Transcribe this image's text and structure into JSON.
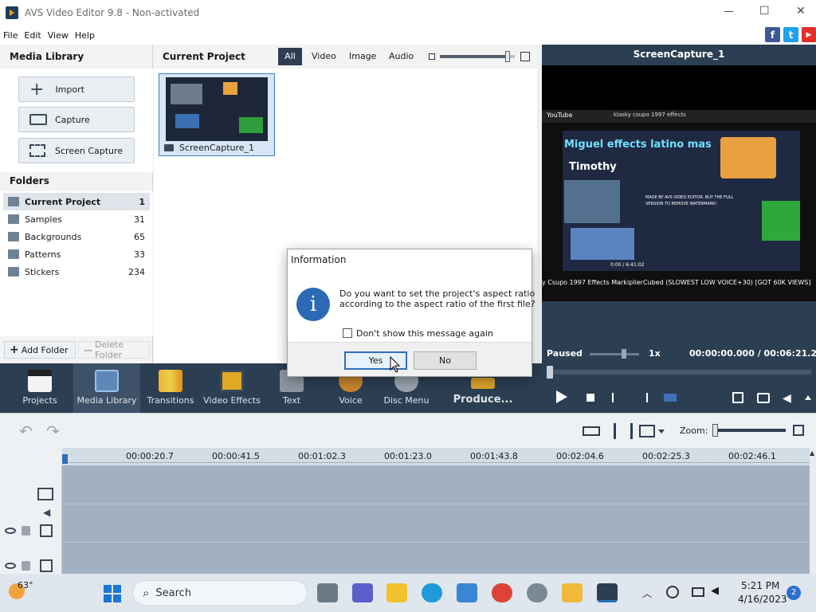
{
  "window": {
    "title": "AVS Video Editor 9.8 - Non-activated",
    "minimize": "—",
    "maximize": "☐",
    "close": "✕"
  },
  "menu": [
    "File",
    "Edit",
    "View",
    "Help"
  ],
  "social": {
    "facebook": "f",
    "twitter": "t",
    "youtube": "▶"
  },
  "media_library": {
    "title": "Media Library",
    "buttons": {
      "import": "Import",
      "capture": "Capture",
      "screen_capture": "Screen Capture"
    },
    "folders_title": "Folders",
    "folders": [
      {
        "name": "Current Project",
        "count": "1"
      },
      {
        "name": "Samples",
        "count": "31"
      },
      {
        "name": "Backgrounds",
        "count": "65"
      },
      {
        "name": "Patterns",
        "count": "33"
      },
      {
        "name": "Stickers",
        "count": "234"
      }
    ],
    "add_folder": "Add Folder",
    "delete_folder": "Delete Folder"
  },
  "project": {
    "title": "Current Project",
    "filters": [
      "All",
      "Video",
      "Image",
      "Audio"
    ],
    "zoom_level": 0.9,
    "clip_name": "ScreenCapture_1"
  },
  "preview": {
    "title": "ScreenCapture_1",
    "video_caption": "Miguel effects latino mas",
    "video_subtitle": "Timothy",
    "video_search": "klasky csupo 1997 effects",
    "video_title_text": "y Csupo 1997 Effects MarkiplierCubed (SLOWEST LOW VOICE+30) [GOT 60K VIEWS]",
    "watermark": "MADE BY AVS VIDEO EDITOR. BUY THE FULL VERSION TO REMOVE WATERMARK!",
    "youtube_label": "YouTube",
    "video_time": "0:00 / 6:41:02",
    "status": "Paused",
    "speed": "1x",
    "time": "00:00:00.000 / 00:06:21.200",
    "progress": 0.0
  },
  "toolbar": [
    {
      "label": "Projects",
      "icon": "clapper-icon"
    },
    {
      "label": "Media Library",
      "icon": "media-library-icon"
    },
    {
      "label": "Transitions",
      "icon": "transitions-icon"
    },
    {
      "label": "Video Effects",
      "icon": "video-effects-icon"
    },
    {
      "label": "Text",
      "icon": "text-icon"
    },
    {
      "label": "Voice",
      "icon": "microphone-icon"
    },
    {
      "label": "Disc Menu",
      "icon": "disc-menu-icon"
    },
    {
      "label": "Produce...",
      "icon": "produce-icon"
    }
  ],
  "timeline": {
    "ticks": [
      "00:00:20.7",
      "00:00:41.5",
      "00:01:02.3",
      "00:01:23.0",
      "00:01:43.8",
      "00:02:04.6",
      "00:02:25.3",
      "00:02:46.1"
    ],
    "zoom_label": "Zoom:"
  },
  "dialog": {
    "title": "Information",
    "message_line1": "Do you want to set the project's aspect ratio",
    "message_line2": "according to the aspect ratio of the first file?",
    "checkbox_label": "Don't show this message again",
    "yes": "Yes",
    "no": "No",
    "info_glyph": "i"
  },
  "taskbar": {
    "weather": "63°",
    "search_placeholder": "Search",
    "time": "5:21 PM",
    "date": "4/16/2023",
    "notifications": "2"
  },
  "colors": {
    "accent": "#2f6fb8",
    "toolbar": "#2c3e52",
    "timeline": "#a2b1c2"
  }
}
